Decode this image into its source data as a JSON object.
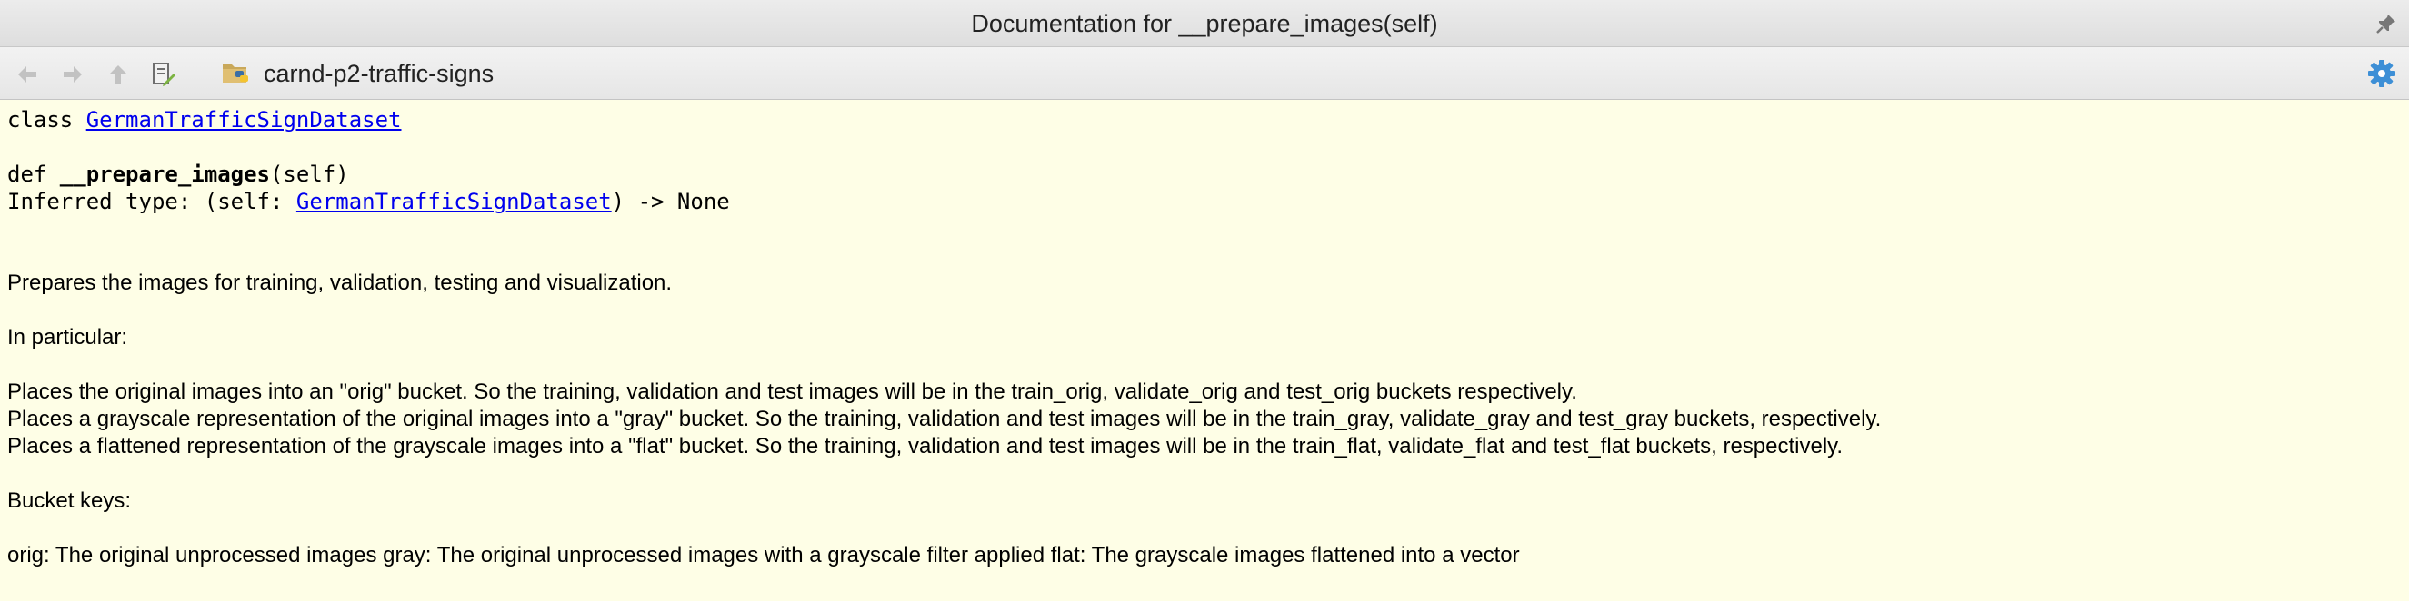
{
  "window": {
    "title": "Documentation for __prepare_images(self)"
  },
  "toolbar": {
    "back_icon": "arrow-left-icon",
    "forward_icon": "arrow-right-icon",
    "up_icon": "arrow-up-icon",
    "edit_source_icon": "edit-source-icon",
    "breadcrumb_label": "carnd-p2-traffic-signs",
    "settings_icon": "gear-icon"
  },
  "doc": {
    "class_keyword": "class ",
    "class_name": "GermanTrafficSignDataset",
    "def_keyword": "def ",
    "func_name": "__prepare_images",
    "func_args": "(self)",
    "inferred_prefix": "Inferred type: (self: ",
    "inferred_type_link": "GermanTrafficSignDataset",
    "inferred_suffix": ") -> None",
    "summary": "Prepares the images for training, validation, testing and visualization.",
    "in_particular": "In particular:",
    "details": [
      "Places the original images into an \"orig\" bucket. So the training, validation and test images will be in the train_orig, validate_orig and test_orig buckets respectively.",
      "Places a grayscale representation of the original images into a \"gray\" bucket. So the training, validation and test images will be in the train_gray, validate_gray and test_gray buckets, respectively.",
      "Places a flattened representation of the grayscale images into a \"flat\" bucket. So the training, validation and test images will be in the train_flat, validate_flat and test_flat buckets, respectively."
    ],
    "bucket_keys_heading": "Bucket keys:",
    "bucket_keys_text": "orig: The original unprocessed images gray: The original unprocessed images with a grayscale filter applied flat: The grayscale images flattened into a vector"
  },
  "colors": {
    "background": "#fefee6",
    "link": "#0000ee",
    "settings_icon": "#3d8fd6"
  }
}
